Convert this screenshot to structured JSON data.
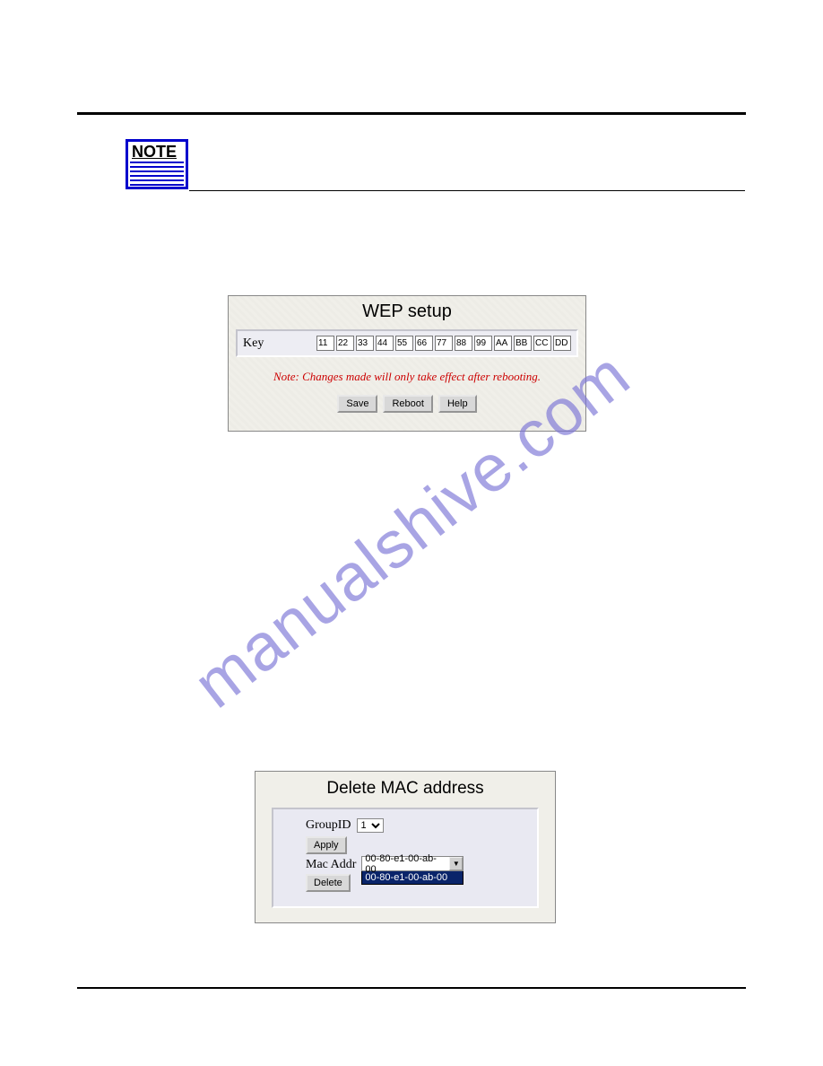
{
  "note_icon": {
    "label": "NOTE"
  },
  "watermark": "manualshive.com",
  "wep": {
    "title": "WEP setup",
    "key_label": "Key",
    "keys": [
      "11",
      "22",
      "33",
      "44",
      "55",
      "66",
      "77",
      "88",
      "99",
      "AA",
      "BB",
      "CC",
      "DD"
    ],
    "note": "Note: Changes made will only take effect after rebooting.",
    "buttons": {
      "save": "Save",
      "reboot": "Reboot",
      "help": "Help"
    }
  },
  "mac": {
    "title": "Delete MAC address",
    "group_label": "GroupID",
    "group_value": "1",
    "apply": "Apply",
    "addr_label": "Mac Addr",
    "addr_value": "00-80-e1-00-ab-00",
    "addr_options": [
      "00-80-e1-00-ab-00"
    ],
    "delete": "Delete"
  }
}
